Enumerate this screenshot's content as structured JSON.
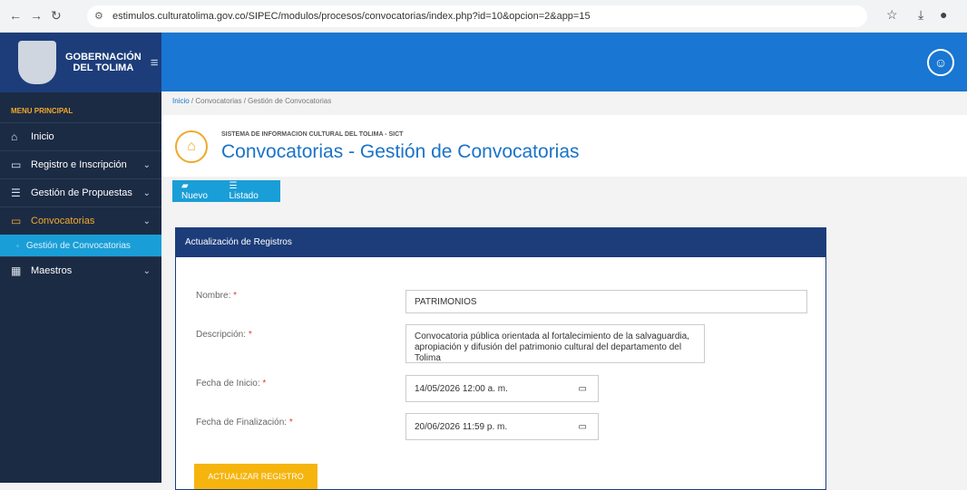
{
  "browser": {
    "url": "estimulos.culturatolima.gov.co/SIPEC/modulos/procesos/convocatorias/index.php?id=10&opcion=2&app=15"
  },
  "logo": {
    "line1": "GOBERNACIÓN",
    "line2": "DEL TOLIMA"
  },
  "sidebar": {
    "heading": "MENU PRINCIPAL",
    "items": [
      {
        "label": "Inicio",
        "icon": "home-icon"
      },
      {
        "label": "Registro e Inscripción",
        "icon": "inbox-icon"
      },
      {
        "label": "Gestión de Propuestas",
        "icon": "list-icon"
      },
      {
        "label": "Convocatorias",
        "icon": "calendar-icon"
      },
      {
        "label": "Maestros",
        "icon": "table-icon"
      }
    ],
    "sub_item": "Gestión de Convocatorias"
  },
  "breadcrumb": {
    "home": "Inicio",
    "rest": " / Convocatorias / Gestión de Convocatorias"
  },
  "page": {
    "subtitle": "SISTEMA DE INFORMACION CULTURAL DEL TOLIMA - SICT",
    "title": "Convocatorias - Gestión de Convocatorias"
  },
  "toolbar": {
    "new": "Nuevo",
    "list": "Listado"
  },
  "card": {
    "title": "Actualización de Registros",
    "nombre_label": "Nombre:",
    "nombre_value": "PATRIMONIOS",
    "desc_label": "Descripción:",
    "desc_value": "Convocatoria pública orientada al fortalecimiento de la salvaguardia, apropiación y difusión del patrimonio cultural del departamento del Tolima",
    "inicio_label": "Fecha de Inicio:",
    "inicio_value": "14/05/2026 12:00 a. m.",
    "fin_label": "Fecha de Finalización:",
    "fin_value": "20/06/2026 11:59 p. m.",
    "submit": "ACTUALIZAR REGISTRO"
  }
}
